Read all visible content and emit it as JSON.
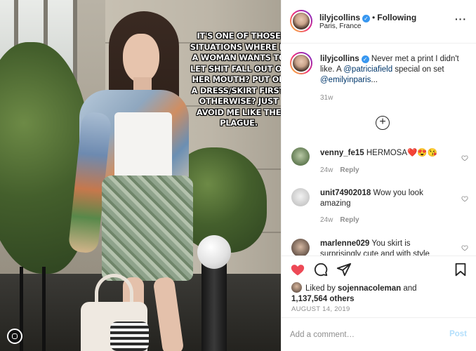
{
  "meme": {
    "caption": "IT'S ONE OF THOSE SITUATIONS WHERE IF A WOMAN WANTS TO LET SHIT FALL OUT OF HER MOUTH? PUT ON A DRESS/SKIRT FIRST, OTHERWISE? JUST AVOID ME LIKE THE PLAGUE."
  },
  "header": {
    "username": "lilyjcollins",
    "follow_status": "Following",
    "location": "Paris, France",
    "more_icon": "ellipsis-icon"
  },
  "caption": {
    "username": "lilyjcollins",
    "text_before": "Never met a print I didn't like. A ",
    "mention1": "@patriciafield",
    "text_middle": " special on set ",
    "mention2": "@emilyinparis",
    "text_after": "...",
    "time": "31w"
  },
  "load_more_icon": "plus-circle-icon",
  "comments": [
    {
      "username": "venny_fe15",
      "text": "HERMOSA❤️😍😘",
      "time": "24w",
      "reply": "Reply"
    },
    {
      "username": "unit74902018",
      "text": "Wow you look amazing",
      "time": "24w",
      "reply": "Reply"
    },
    {
      "username": "marlenne029",
      "text": "You skirt is surprisingly cute and with style",
      "time": "",
      "reply": ""
    }
  ],
  "actions": {
    "icons": [
      "heart-filled-icon",
      "comment-icon",
      "share-icon",
      "bookmark-icon"
    ],
    "liked_prefix": "Liked by ",
    "liked_user": "sojennacoleman",
    "liked_and": " and",
    "liked_count": "1,137,564 others",
    "date": "AUGUST 14, 2019"
  },
  "add_comment": {
    "placeholder": "Add a comment…",
    "post_label": "Post"
  },
  "colors": {
    "like_red": "#ed4956",
    "link_blue": "#00376b",
    "post_disabled": "#b2dffc",
    "verified_blue": "#3897f0"
  }
}
